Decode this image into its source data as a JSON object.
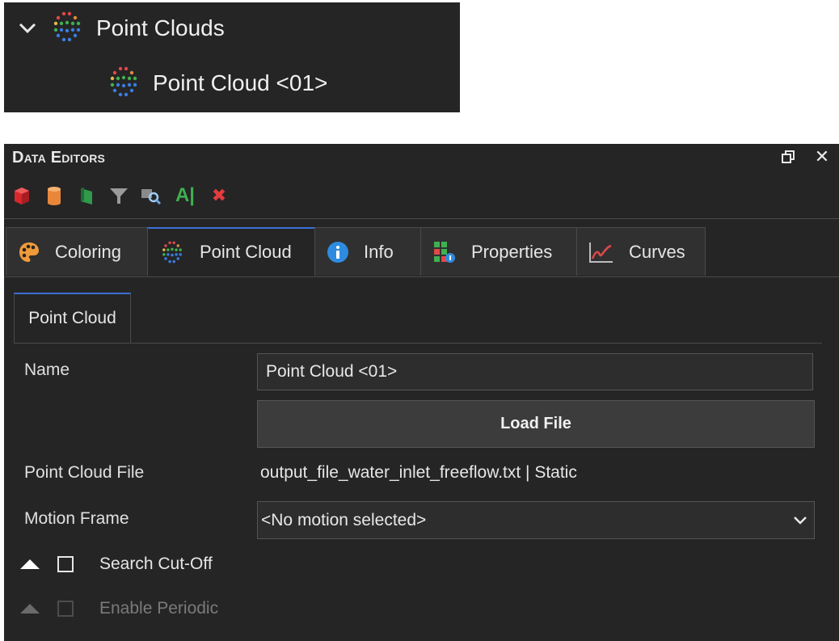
{
  "tree": {
    "parent_label": "Point Clouds",
    "child_label": "Point Cloud <01>"
  },
  "panel": {
    "title": "Data Editors",
    "restore_icon": "restore-window-icon",
    "close_glyph": "✕"
  },
  "toolbar": {
    "icons": [
      "red-box-icon",
      "orange-cylinder-icon",
      "green-plane-icon",
      "filter-icon",
      "search-object-icon",
      "text-cursor-icon",
      "delete-icon"
    ],
    "text_icon_glyph": "A|",
    "delete_glyph": "✖"
  },
  "tabs": [
    {
      "label": "Coloring",
      "icon": "palette-icon"
    },
    {
      "label": "Point Cloud",
      "icon": "point-cloud-icon"
    },
    {
      "label": "Info",
      "icon": "info-icon"
    },
    {
      "label": "Properties",
      "icon": "properties-grid-icon"
    },
    {
      "label": "Curves",
      "icon": "curves-icon"
    }
  ],
  "subtab": {
    "label": "Point Cloud"
  },
  "form": {
    "name_label": "Name",
    "name_value": "Point Cloud <01>",
    "load_button": "Load File",
    "file_label": "Point Cloud File",
    "file_value": "output_file_water_inlet_freeflow.txt | Static",
    "motion_label": "Motion Frame",
    "motion_value": "<No motion selected>",
    "search_cutoff_label": "Search Cut-Off",
    "enable_periodic_label": "Enable Periodic"
  },
  "colors": {
    "background": "#252526",
    "accent": "#3b6fd8",
    "delete": "#e23c3c"
  }
}
